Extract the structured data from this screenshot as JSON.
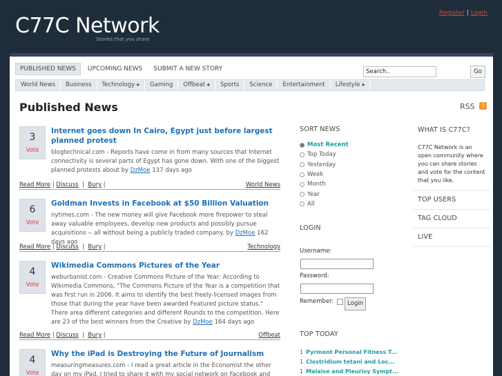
{
  "site": {
    "name": "C77C Network",
    "tagline": "Stories that you share"
  },
  "auth": {
    "register": "Register",
    "separator": "|",
    "login": "Login"
  },
  "nav": {
    "tabs": [
      "PUBLISHED NEWS",
      "UPCOMING NEWS",
      "SUBMIT A NEW STORY"
    ],
    "active_tab": "PUBLISHED NEWS",
    "search_value": "Search..",
    "go_label": "Go",
    "categories": [
      {
        "label": "World News",
        "dropdown": false
      },
      {
        "label": "Business",
        "dropdown": false
      },
      {
        "label": "Technology",
        "dropdown": true
      },
      {
        "label": "Gaming",
        "dropdown": false
      },
      {
        "label": "Offbeat",
        "dropdown": true
      },
      {
        "label": "Sports",
        "dropdown": false
      },
      {
        "label": "Science",
        "dropdown": false
      },
      {
        "label": "Entertainment",
        "dropdown": false
      },
      {
        "label": "Lifestyle",
        "dropdown": true
      }
    ]
  },
  "main": {
    "title": "Published News",
    "rss_label": "RSS",
    "stories": [
      {
        "votes": "3",
        "vote_label": "Vote",
        "title": "Internet goes down In Cairo, Egypt just before largest planned protest",
        "desc": "blogtechnical.com - Reports have come in from many sources that Internet connectivity is several parts of Egypt has gone down. With one of the biggest planned protests about by",
        "author": "DzMoe",
        "age": "137 days ago",
        "read_more": "Read More",
        "discuss": "Discuss",
        "bury": "Bury",
        "category": "World News"
      },
      {
        "votes": "6",
        "vote_label": "Vote",
        "title": "Goldman Invests in Facebook at $50 Billion Valuation",
        "desc": "nytimes.com - The new money will give Facebook more firepower to steal away valuable employees, develop new products and possibly pursue acquisitions -- all without being a publicly traded company. by",
        "author": "DzMoe",
        "age": "162 days ago",
        "read_more": "Read More",
        "discuss": "Discuss",
        "bury": "Bury",
        "category": "Technology"
      },
      {
        "votes": "4",
        "vote_label": "Vote",
        "title": "Wikimedia Commons Pictures of the Year",
        "desc": "weburbanist.com - Creative Commons Picture of the Year: According to Wikimedia Commons, \"The Commons Picture of the Year is a competition that was first run in 2006. It aims to identify the best freely-licensed images from those that during the year have been awarded Featured picture status.\" There area different categories and different Rounds to the competition. Here are 23 of the best winners from the Creative by",
        "author": "DzMoe",
        "age": "164 days ago",
        "read_more": "Read More",
        "discuss": "Discuss",
        "bury": "Bury",
        "category": "Offbeat"
      },
      {
        "votes": "4",
        "vote_label": "Vote",
        "title": "Why the iPad is Destroying the Future of Journalism",
        "desc": "measuringmeasures.com - I read a great article in the Economist the other day on my iPad. I tried to share it with my social network on Facebook and Twitter,",
        "author": "",
        "age": "",
        "read_more": "",
        "discuss": "",
        "bury": "",
        "category": ""
      }
    ]
  },
  "sort": {
    "heading": "SORT NEWS",
    "options": [
      "Most Recent",
      "Top Today",
      "Yesterday",
      "Week",
      "Month",
      "Year",
      "All"
    ],
    "selected": "Most Recent"
  },
  "login": {
    "heading": "LOGIN",
    "username_label": "Username:",
    "password_label": "Password:",
    "remember_label": "Remember:",
    "button": "Login"
  },
  "top_today": {
    "heading": "TOP TODAY",
    "items": [
      {
        "rank": "1",
        "title": "Pyrmont Personal Fitness T..."
      },
      {
        "rank": "1",
        "title": "Clostridium tetani and Loc..."
      },
      {
        "rank": "1",
        "title": "Malaise and Pleurisy Sympt..."
      }
    ]
  },
  "sidebar": {
    "what_heading": "WHAT IS C77C?",
    "about": "C77C Network is an open community where you can share stories and vote for the content that you like.",
    "top_users": "TOP USERS",
    "tag_cloud": "TAG CLOUD",
    "live": "LIVE"
  },
  "colors": {
    "background": "#1f2d3a",
    "accent": "#1f6fb5",
    "highlight": "#1f9aa5",
    "alert": "#e0443a"
  }
}
